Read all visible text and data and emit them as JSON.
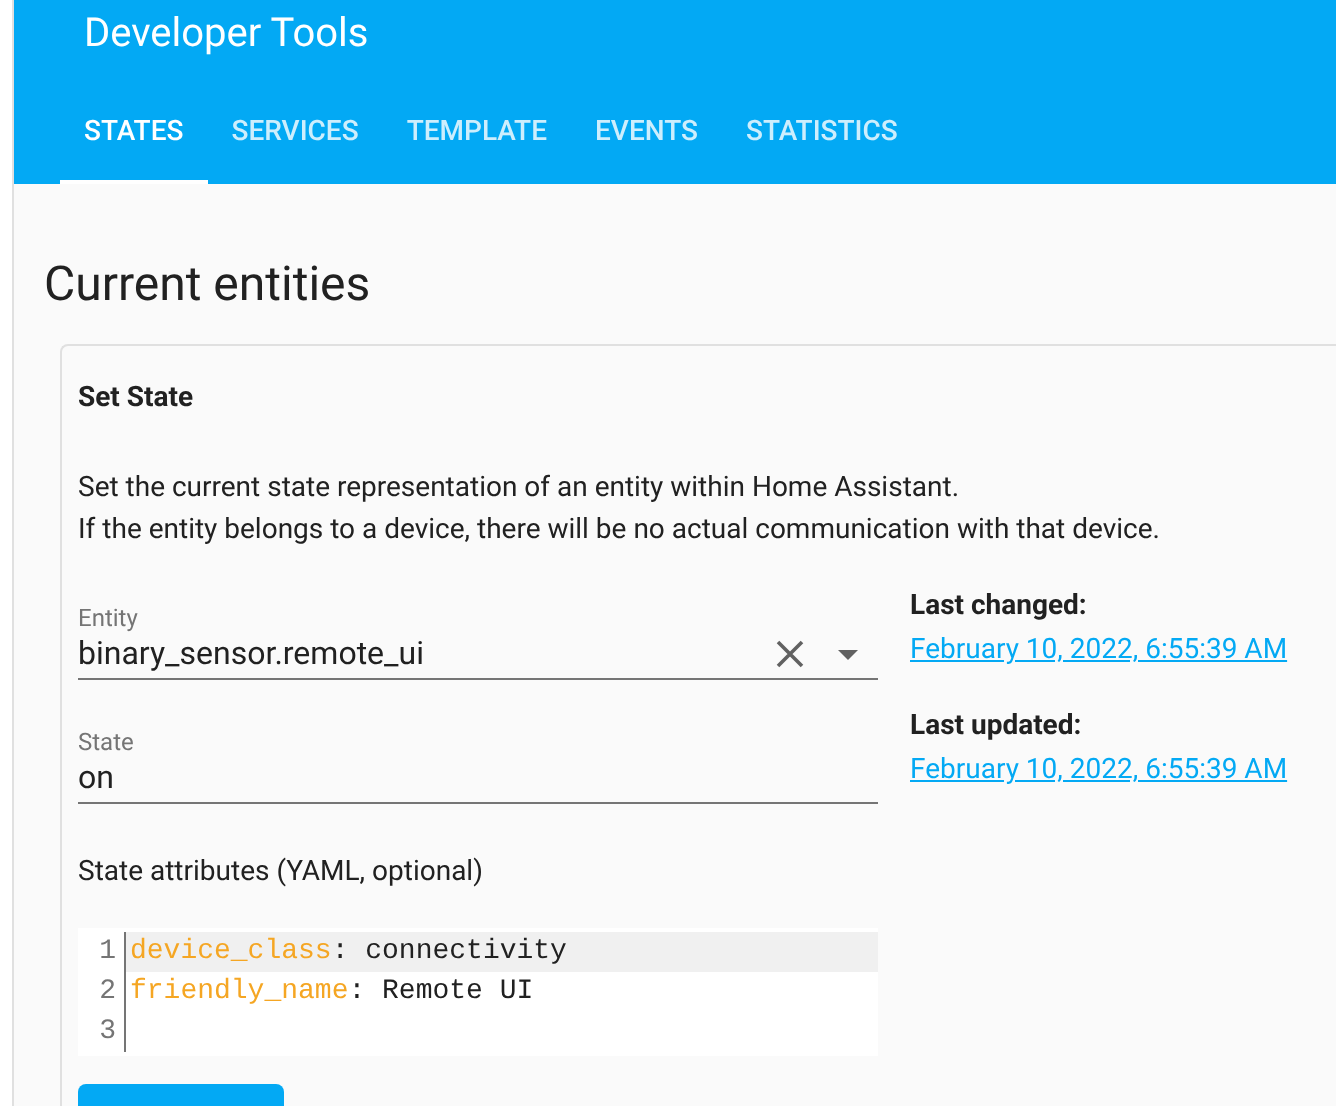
{
  "header": {
    "title": "Developer Tools"
  },
  "tabs": [
    {
      "label": "STATES",
      "selected": true
    },
    {
      "label": "SERVICES",
      "selected": false
    },
    {
      "label": "TEMPLATE",
      "selected": false
    },
    {
      "label": "EVENTS",
      "selected": false
    },
    {
      "label": "STATISTICS",
      "selected": false
    }
  ],
  "page_title": "Current entities",
  "card": {
    "title": "Set State",
    "description": [
      "Set the current state representation of an entity within Home Assistant.",
      "If the entity belongs to a device, there will be no actual communication with that device."
    ],
    "entity_field": {
      "label": "Entity",
      "value": "binary_sensor.remote_ui"
    },
    "state_field": {
      "label": "State",
      "value": "on"
    },
    "attributes_label": "State attributes (YAML, optional)",
    "code_lines": [
      {
        "number": "1",
        "key": "device_class",
        "value": ": connectivity",
        "active": true
      },
      {
        "number": "2",
        "key": "friendly_name",
        "value": ": Remote UI",
        "active": false
      },
      {
        "number": "3",
        "active": false
      }
    ],
    "timestamps": [
      {
        "label": "Last changed:",
        "value": "February 10, 2022, 6:55:39 AM"
      },
      {
        "label": "Last updated:",
        "value": "February 10, 2022, 6:55:39 AM"
      }
    ]
  }
}
